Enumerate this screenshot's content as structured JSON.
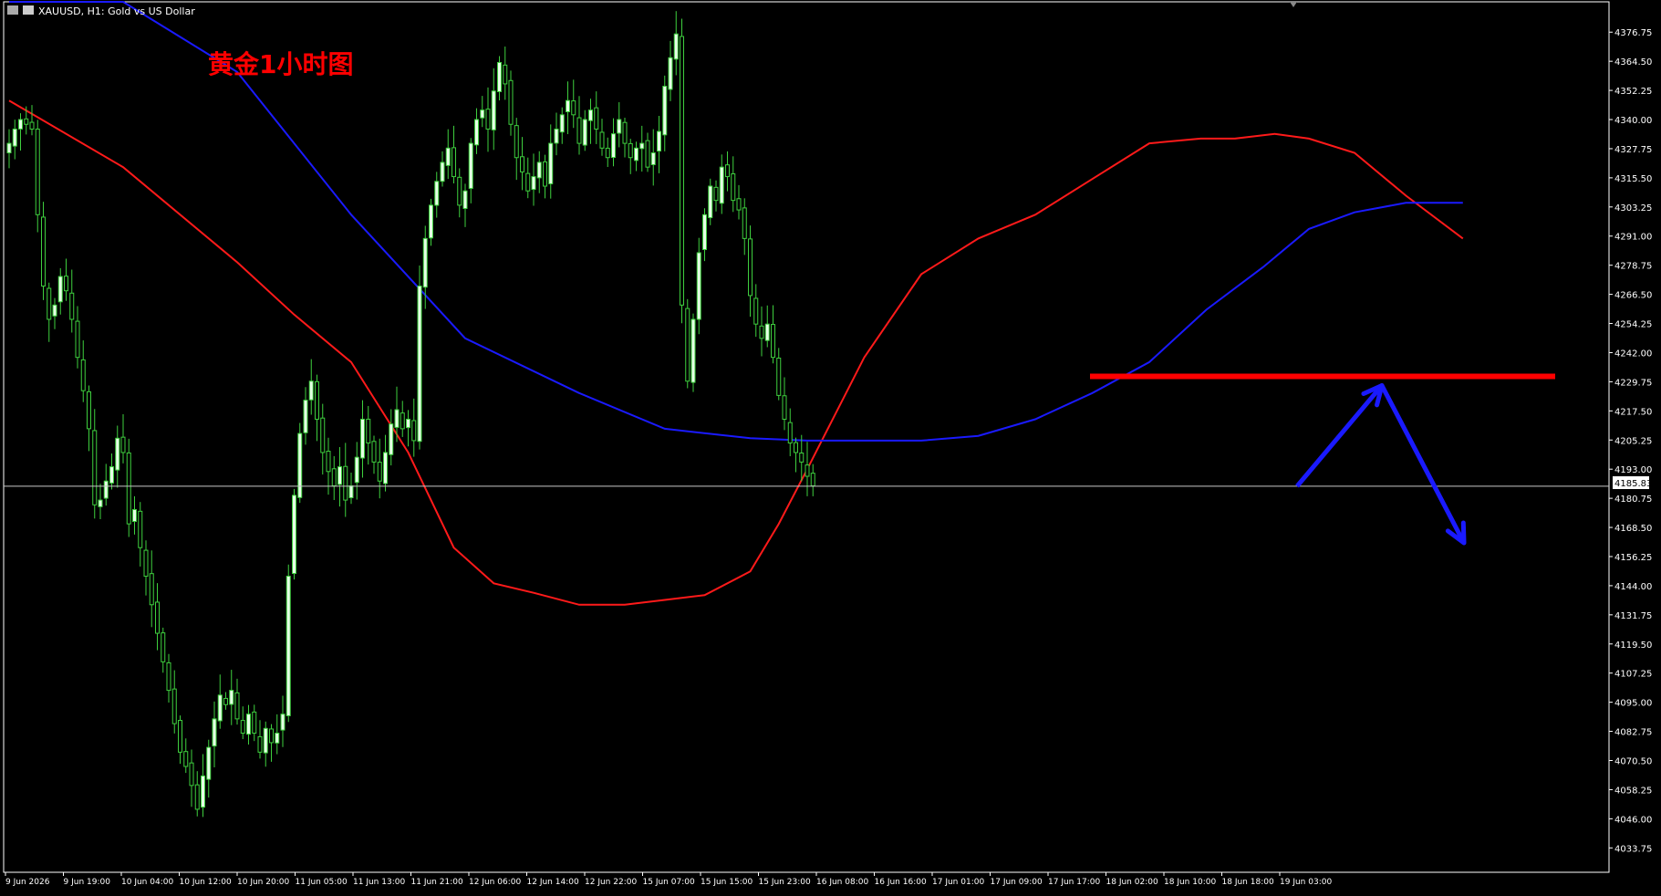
{
  "window": {
    "symbol_title": "XAUUSD, H1:  Gold vs US Dollar"
  },
  "annotation": {
    "title": "黄金1小时图",
    "title_color": "#ff0000"
  },
  "colors": {
    "background": "#000000",
    "axis": "#ffffff",
    "candle_bull_body": "#e6ffe6",
    "candle_bear_body": "#000000",
    "candle_wick": "#3ecf3e",
    "ma_fast": "#ff1a1a",
    "ma_slow": "#1a1aff",
    "price_line": "#c8c8c8",
    "resistance_line": "#ff0000",
    "forecast_arrow": "#1a1aff"
  },
  "chart_data": {
    "type": "candlestick",
    "symbol": "XAUUSD",
    "timeframe": "H1",
    "current_price": "4185.83",
    "y_range": [
      4023.5,
      4389.5
    ],
    "y_ticks": [
      "4376.75",
      "4364.50",
      "4352.25",
      "4340.00",
      "4327.75",
      "4315.50",
      "4303.25",
      "4291.00",
      "4278.75",
      "4266.50",
      "4254.25",
      "4242.00",
      "4229.75",
      "4217.50",
      "4205.25",
      "4193.00",
      "4180.75",
      "4168.50",
      "4156.25",
      "4144.00",
      "4131.75",
      "4119.50",
      "4107.25",
      "4095.00",
      "4082.75",
      "4070.50",
      "4058.25",
      "4046.00",
      "4033.75"
    ],
    "x_ticks": [
      "9 Jun 2026",
      "9 Jun 19:00",
      "10 Jun 04:00",
      "10 Jun 12:00",
      "10 Jun 20:00",
      "11 Jun 05:00",
      "11 Jun 13:00",
      "11 Jun 21:00",
      "12 Jun 06:00",
      "12 Jun 14:00",
      "12 Jun 22:00",
      "15 Jun 07:00",
      "15 Jun 15:00",
      "15 Jun 23:00",
      "16 Jun 08:00",
      "16 Jun 16:00",
      "17 Jun 01:00",
      "17 Jun 09:00",
      "17 Jun 17:00",
      "18 Jun 02:00",
      "18 Jun 10:00",
      "18 Jun 18:00",
      "19 Jun 03:00"
    ],
    "closes": [
      4330,
      4336,
      4340,
      4338,
      4336,
      4300,
      4270,
      4256,
      4262,
      4274,
      4268,
      4256,
      4240,
      4226,
      4210,
      4178,
      4180,
      4188,
      4194,
      4206,
      4200,
      4170,
      4176,
      4160,
      4148,
      4136,
      4124,
      4112,
      4100,
      4086,
      4074,
      4068,
      4060,
      4050,
      4064,
      4076,
      4088,
      4098,
      4094,
      4100,
      4088,
      4082,
      4090,
      4082,
      4074,
      4084,
      4078,
      4082,
      4090,
      4148,
      4182,
      4208,
      4222,
      4230,
      4214,
      4200,
      4192,
      4186,
      4194,
      4180,
      4186,
      4198,
      4214,
      4204,
      4196,
      4188,
      4200,
      4212,
      4218,
      4210,
      4214,
      4205,
      4270,
      4290,
      4304,
      4314,
      4322,
      4328,
      4316,
      4304,
      4310,
      4330,
      4340,
      4344,
      4336,
      4352,
      4364,
      4355,
      4338,
      4324,
      4318,
      4310,
      4316,
      4322,
      4312,
      4330,
      4336,
      4342,
      4348,
      4342,
      4330,
      4340,
      4344,
      4336,
      4328,
      4324,
      4334,
      4340,
      4330,
      4324,
      4328,
      4330,
      4320,
      4326,
      4335,
      4354,
      4366,
      4376,
      4262,
      4230,
      4256,
      4284,
      4300,
      4312,
      4306,
      4320,
      4316,
      4306,
      4302,
      4290,
      4266,
      4254,
      4248,
      4254,
      4240,
      4224,
      4214,
      4204,
      4200,
      4196,
      4190,
      4186
    ],
    "series": [
      {
        "name": "MA fast",
        "color": "#ff1a1a",
        "points": [
          [
            0,
            4348
          ],
          [
            20,
            4320
          ],
          [
            40,
            4280
          ],
          [
            50,
            4258
          ],
          [
            60,
            4238
          ],
          [
            70,
            4200
          ],
          [
            78,
            4160
          ],
          [
            85,
            4145
          ],
          [
            92,
            4141
          ],
          [
            100,
            4136
          ],
          [
            108,
            4136
          ],
          [
            115,
            4138
          ],
          [
            122,
            4140
          ],
          [
            130,
            4150
          ],
          [
            135,
            4170
          ],
          [
            140,
            4193
          ],
          [
            150,
            4240
          ],
          [
            160,
            4275
          ],
          [
            170,
            4290
          ],
          [
            180,
            4300
          ],
          [
            190,
            4315
          ],
          [
            200,
            4330
          ],
          [
            209,
            4332
          ],
          [
            215,
            4332
          ],
          [
            222,
            4334
          ],
          [
            228,
            4332
          ],
          [
            236,
            4326
          ],
          [
            245,
            4308
          ],
          [
            255,
            4290
          ]
        ]
      },
      {
        "name": "MA slow",
        "color": "#1a1aff",
        "points": [
          [
            0,
            4430
          ],
          [
            20,
            4405
          ],
          [
            40,
            4360
          ],
          [
            60,
            4300
          ],
          [
            80,
            4248
          ],
          [
            100,
            4225
          ],
          [
            115,
            4210
          ],
          [
            130,
            4206
          ],
          [
            140,
            4205
          ],
          [
            150,
            4205
          ],
          [
            160,
            4205
          ],
          [
            170,
            4207
          ],
          [
            180,
            4214
          ],
          [
            190,
            4225
          ],
          [
            200,
            4238
          ],
          [
            210,
            4260
          ],
          [
            220,
            4278
          ],
          [
            228,
            4294
          ],
          [
            236,
            4301
          ],
          [
            245,
            4305
          ],
          [
            255,
            4305
          ]
        ]
      }
    ],
    "annotations": {
      "resistance_level": 4232,
      "forecast_arrows": [
        {
          "from_price": 4185.83,
          "to_price": 4232
        },
        {
          "from_price": 4232,
          "to_price": 4162
        }
      ]
    }
  }
}
